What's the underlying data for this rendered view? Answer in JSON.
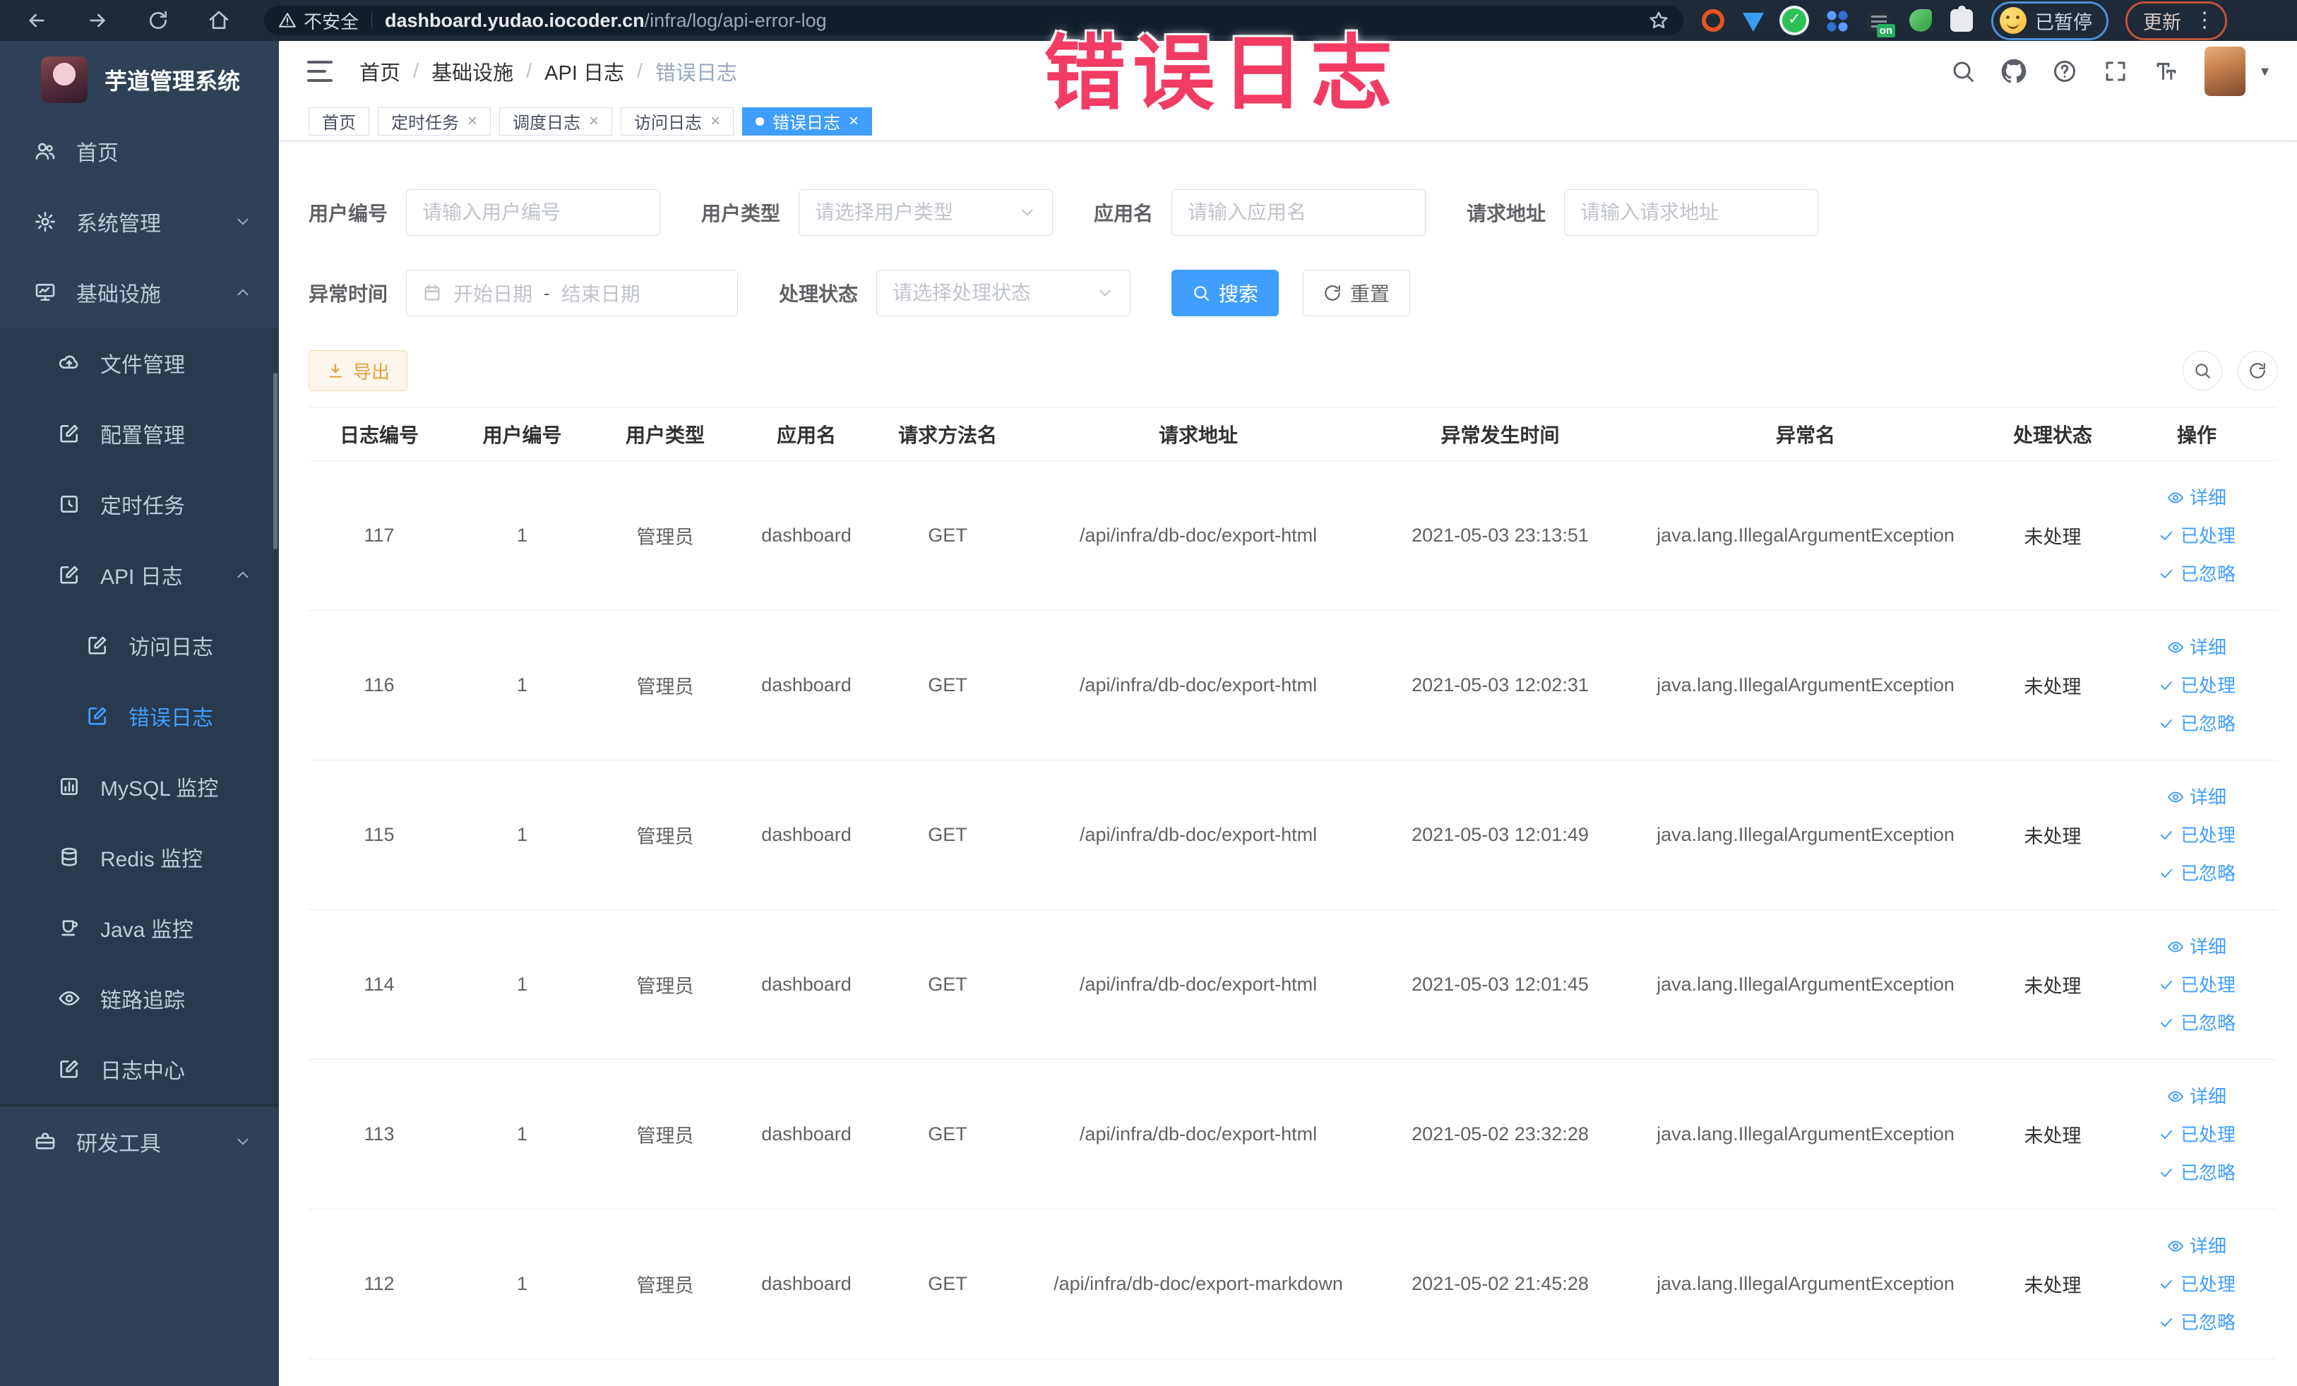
{
  "overlay": {
    "text": "错误日志",
    "color": "#f23c64"
  },
  "browser": {
    "security_label": "不安全",
    "url_host": "dashboard.yudao.iocoder.cn",
    "url_path": "/infra/log/api-error-log",
    "extensions": [
      "circle-orange-icon",
      "drop-blue-icon",
      "check-green-icon",
      "grid-blue-icon",
      "switch-on-icon",
      "leaf-green-icon",
      "puzzle-icon"
    ],
    "paused_badge": "已暂停",
    "update_badge": "更新"
  },
  "sidebar": {
    "title": "芋道管理系统",
    "items": [
      {
        "label": "首页",
        "icon": "home",
        "level": 1
      },
      {
        "label": "系统管理",
        "icon": "gear",
        "level": 1,
        "chevron": "down"
      },
      {
        "label": "基础设施",
        "icon": "infra",
        "level": 1,
        "chevron": "up"
      },
      {
        "label": "文件管理",
        "icon": "cloud",
        "level": 2,
        "sub": true
      },
      {
        "label": "配置管理",
        "icon": "edit",
        "level": 2,
        "sub": true
      },
      {
        "label": "定时任务",
        "icon": "job",
        "level": 2,
        "sub": true
      },
      {
        "label": "API 日志",
        "icon": "log",
        "level": 2,
        "sub": true,
        "chevron": "up"
      },
      {
        "label": "访问日志",
        "icon": "log",
        "level": 3,
        "sub": true
      },
      {
        "label": "错误日志",
        "icon": "log",
        "level": 3,
        "sub": true,
        "active": true
      },
      {
        "label": "MySQL 监控",
        "icon": "chart",
        "level": 2,
        "sub": true
      },
      {
        "label": "Redis 监控",
        "icon": "redis",
        "level": 2,
        "sub": true
      },
      {
        "label": "Java 监控",
        "icon": "java",
        "level": 2,
        "sub": true
      },
      {
        "label": "链路追踪",
        "icon": "eye",
        "level": 2,
        "sub": true
      },
      {
        "label": "日志中心",
        "icon": "log",
        "level": 2,
        "sub": true
      },
      {
        "label": "研发工具",
        "icon": "tool",
        "level": 1,
        "divider_before": true,
        "chevron": "down"
      }
    ]
  },
  "header": {
    "breadcrumb": [
      "首页",
      "基础设施",
      "API 日志",
      "错误日志"
    ]
  },
  "tabs": [
    {
      "label": "首页",
      "closable": false,
      "active": false
    },
    {
      "label": "定时任务",
      "closable": true,
      "active": false
    },
    {
      "label": "调度日志",
      "closable": true,
      "active": false
    },
    {
      "label": "访问日志",
      "closable": true,
      "active": false
    },
    {
      "label": "错误日志",
      "closable": true,
      "active": true
    }
  ],
  "filters": {
    "user_id": {
      "label": "用户编号",
      "placeholder": "请输入用户编号"
    },
    "user_type": {
      "label": "用户类型",
      "placeholder": "请选择用户类型"
    },
    "app_name": {
      "label": "应用名",
      "placeholder": "请输入应用名"
    },
    "request_url": {
      "label": "请求地址",
      "placeholder": "请输入请求地址"
    },
    "exception_time": {
      "label": "异常时间",
      "start_placeholder": "开始日期",
      "separator": "-",
      "end_placeholder": "结束日期"
    },
    "process_status": {
      "label": "处理状态",
      "placeholder": "请选择处理状态"
    },
    "search_label": "搜索",
    "reset_label": "重置"
  },
  "toolbar": {
    "export_label": "导出"
  },
  "table": {
    "columns": [
      "日志编号",
      "用户编号",
      "用户类型",
      "应用名",
      "请求方法名",
      "请求地址",
      "异常发生时间",
      "异常名",
      "处理状态",
      "操作"
    ],
    "rows": [
      [
        "117",
        "1",
        "管理员",
        "dashboard",
        "GET",
        "/api/infra/db-doc/export-html",
        "2021-05-03 23:13:51",
        "java.lang.IllegalArgumentException",
        "未处理"
      ],
      [
        "116",
        "1",
        "管理员",
        "dashboard",
        "GET",
        "/api/infra/db-doc/export-html",
        "2021-05-03 12:02:31",
        "java.lang.IllegalArgumentException",
        "未处理"
      ],
      [
        "115",
        "1",
        "管理员",
        "dashboard",
        "GET",
        "/api/infra/db-doc/export-html",
        "2021-05-03 12:01:49",
        "java.lang.IllegalArgumentException",
        "未处理"
      ],
      [
        "114",
        "1",
        "管理员",
        "dashboard",
        "GET",
        "/api/infra/db-doc/export-html",
        "2021-05-03 12:01:45",
        "java.lang.IllegalArgumentException",
        "未处理"
      ],
      [
        "113",
        "1",
        "管理员",
        "dashboard",
        "GET",
        "/api/infra/db-doc/export-html",
        "2021-05-02 23:32:28",
        "java.lang.IllegalArgumentException",
        "未处理"
      ],
      [
        "112",
        "1",
        "管理员",
        "dashboard",
        "GET",
        "/api/infra/db-doc/export-markdown",
        "2021-05-02 21:45:28",
        "java.lang.IllegalArgumentException",
        "未处理"
      ]
    ],
    "row_actions": [
      {
        "name": "detail-link",
        "label": "详细",
        "icon": "eye"
      },
      {
        "name": "processed-link",
        "label": "已处理",
        "icon": "check"
      },
      {
        "name": "ignored-link",
        "label": "已忽略",
        "icon": "check"
      }
    ]
  },
  "colors": {
    "accent": "#409eff",
    "warning": "#e6a23c",
    "overlay": "#f23c64"
  }
}
